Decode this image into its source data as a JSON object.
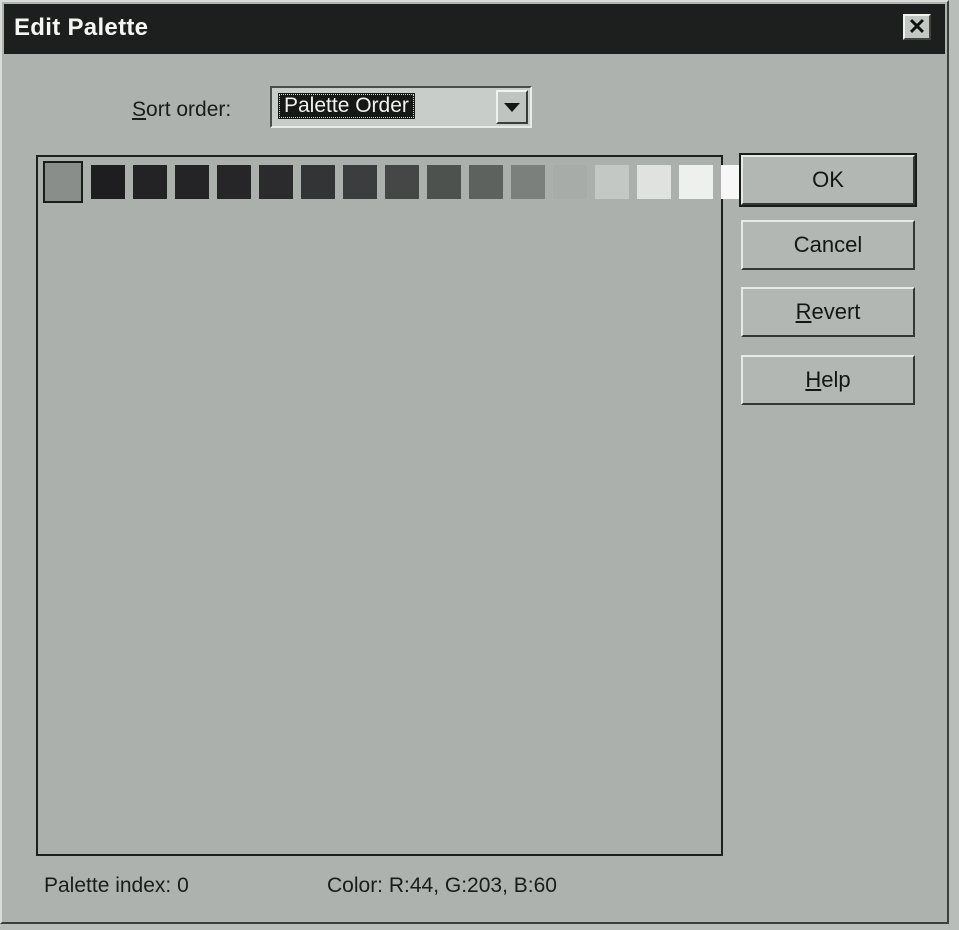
{
  "window": {
    "title": "Edit Palette",
    "close_glyph": "✕"
  },
  "sort": {
    "label_underlined": "S",
    "label_rest": "ort order:",
    "selected": "Palette Order"
  },
  "swatches": [
    "#8a8e8a",
    "#1e1e20",
    "#232224",
    "#242426",
    "#262628",
    "#2b2b2e",
    "#333436",
    "#3b3d3e",
    "#444746",
    "#4e524f",
    "#5e625e",
    "#7c807c",
    "#a8aca8",
    "#c4c8c4",
    "#dfe2df",
    "#eef0ee",
    "#f6f7f6"
  ],
  "buttons": {
    "ok": "OK",
    "cancel": "Cancel",
    "revert_underlined": "R",
    "revert_rest": "evert",
    "help_underlined": "H",
    "help_rest": "elp"
  },
  "status": {
    "palette_index": "Palette index:  0",
    "color": "Color:  R:44, G:203, B:60"
  }
}
